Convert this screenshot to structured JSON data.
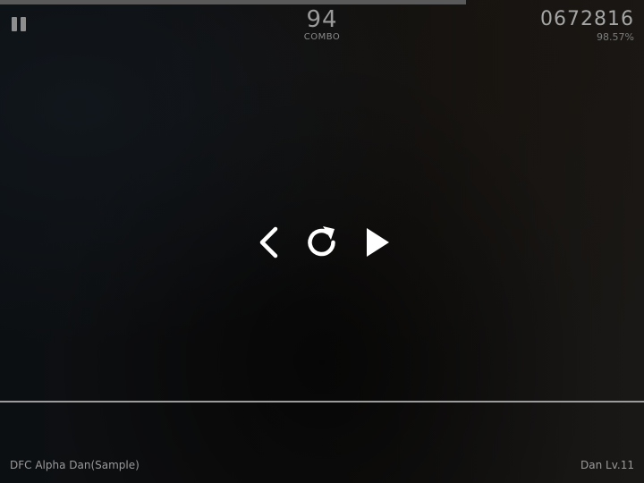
{
  "hud": {
    "progress_fraction": 0.723,
    "combo_value": "94",
    "combo_label": "COMBO",
    "score": "0672816",
    "accuracy": "98.57%"
  },
  "controls": {
    "back_icon": "chevron-left-icon",
    "retry_icon": "retry-icon",
    "play_icon": "play-icon"
  },
  "footer": {
    "chart_title": "DFC Alpha Dan(Sample)",
    "level": "Dan Lv.11"
  },
  "colors": {
    "icon": "#ffffff",
    "judge_line": "#9c9c9c",
    "progress": "#5a5a5a"
  }
}
